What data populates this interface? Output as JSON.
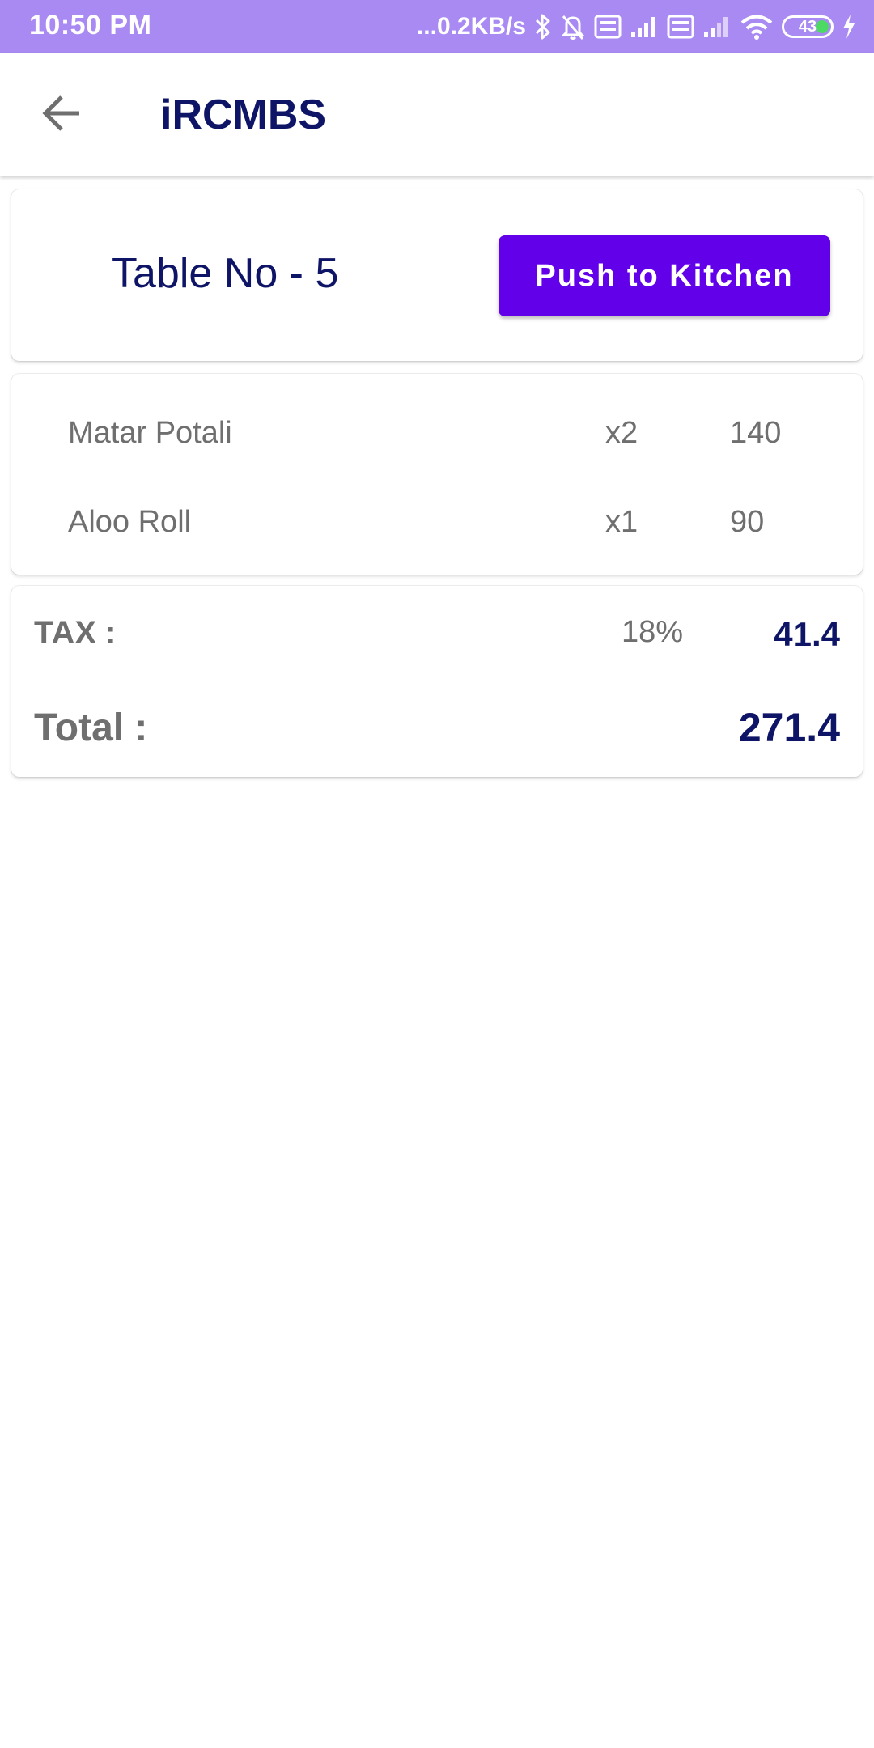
{
  "status_bar": {
    "time": "10:50 PM",
    "network_speed": "...0.2KB/s",
    "battery_level": "43",
    "background_color": "#a88af2",
    "icons": [
      "bluetooth-icon",
      "mute-notifications-icon",
      "volte-icon",
      "signal-icon",
      "volte-icon",
      "signal-icon",
      "wifi-icon",
      "battery-icon",
      "charging-icon"
    ]
  },
  "app_bar": {
    "title": "iRCMBS",
    "back_icon": "arrow-back-icon",
    "title_color": "#0f1566"
  },
  "table_card": {
    "table_label": "Table No - 5",
    "push_button_label": "Push to Kitchen",
    "button_color": "#6200ea"
  },
  "order": {
    "items": [
      {
        "name": "Matar Potali",
        "qty": "x2",
        "price": "140"
      },
      {
        "name": "Aloo Roll",
        "qty": "x1",
        "price": "90"
      }
    ]
  },
  "totals": {
    "tax_label": "TAX :",
    "tax_rate": "18%",
    "tax_amount": "41.4",
    "total_label": "Total :",
    "total_amount": "271.4"
  }
}
